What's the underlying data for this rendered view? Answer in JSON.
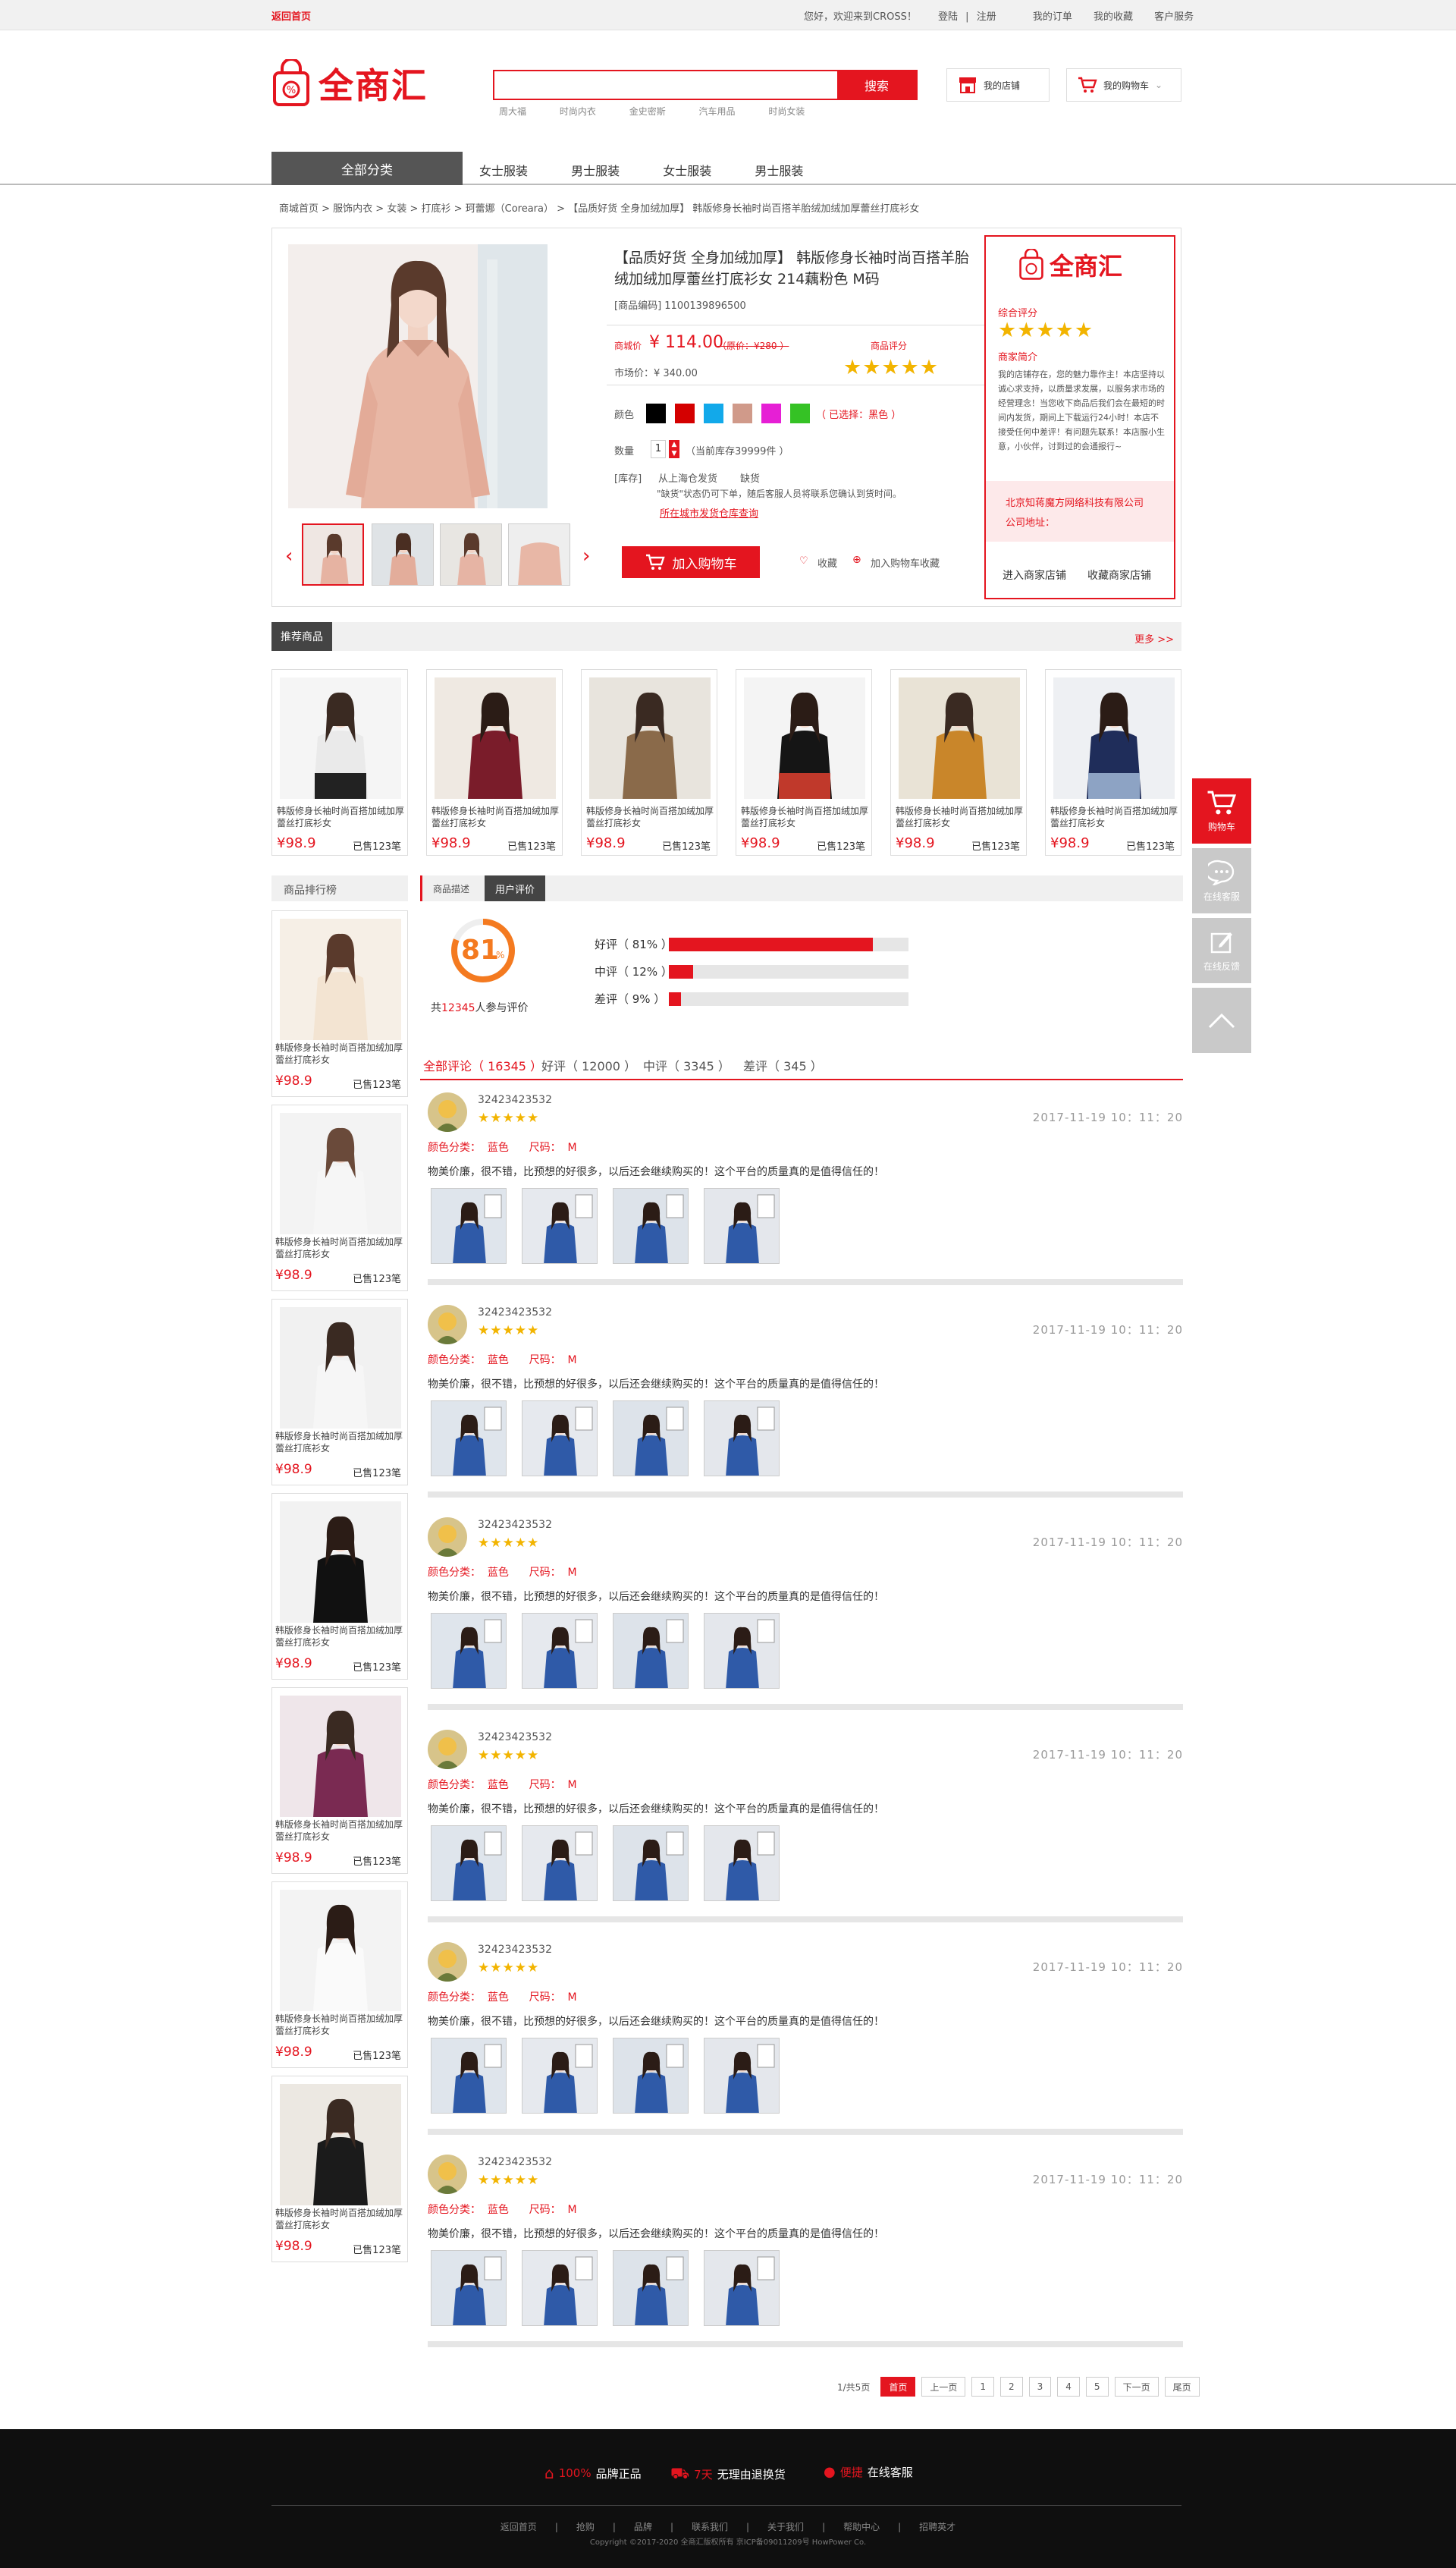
{
  "topbar": {
    "home": "返回首页",
    "greeting": "您好，欢迎来到CROSS！",
    "login": "登陆",
    "sep": "|",
    "register": "注册",
    "orders": "我的订单",
    "favorites": "我的收藏",
    "service": "客户服务"
  },
  "header": {
    "logo": "全商汇",
    "search_placeholder": "",
    "search_btn": "搜索",
    "hot": [
      "周大福",
      "时尚内衣",
      "金史密斯",
      "汽车用品",
      "时尚女装"
    ],
    "store": "我的店铺",
    "cart": "我的购物车"
  },
  "nav": {
    "all": "全部分类",
    "items": [
      "女士服装",
      "男士服装",
      "女士服装",
      "男士服装"
    ]
  },
  "crumb": "商城首页 > 服饰内衣 > 女装 > 打底衫 > 珂蕾娜（Coreara） > 【品质好货 全身加绒加厚】 韩版修身长袖时尚百搭羊胎绒加绒加厚蕾丝打底衫女",
  "product": {
    "title": "【品质好货 全身加绒加厚】 韩版修身长袖时尚百搭羊胎绒加绒加厚蕾丝打底衫女 214藕粉色 M码",
    "code": "[商品编码] 1100139896500",
    "price_label": "商城价",
    "price": "¥ 114.00",
    "orig": "（原价：¥280 ）",
    "market": "市场价：¥ 340.00",
    "rating_label": "商品评分",
    "stars": "★★★★★",
    "color_label": "颜色",
    "color_selected": "（ 已选择：黑色 ）",
    "qty_label": "数量",
    "qty": "1",
    "stock": "（当前库存39999件 ）",
    "ship_label": "[库存]",
    "ship_from": "从上海仓发货",
    "ship_state": "缺货",
    "ship_note": "\"缺货\"状态仍可下单，随后客服人员将联系您确认到货时间。",
    "ship_link": "所在城市发货仓库查询",
    "cart_btn": "加入购物车",
    "fav": "收藏",
    "fav_cart": "加入购物车收藏",
    "swatches": [
      "#000000",
      "#d40000",
      "#12a9ea",
      "#d09a8a",
      "#e61fd5",
      "#35c225"
    ]
  },
  "shop": {
    "logo": "全商汇",
    "score_label": "综合评分",
    "stars": "★★★★★",
    "intro_label": "商家简介",
    "intro": "我的店铺存在，您的魅力靠作主！本店坚持以诚心求支持，以质量求发展，以服务求市场的经营理念！当您收下商品后我们会在最短的时间内发货，期间上下载运行24小时！本店不接受任何中差评！有问题先联系！本店服小生意，小伙伴，讨到过的会通报行~",
    "company": "北京知蒋魔方网络科技有限公司",
    "address": "公司地址：",
    "enter": "进入商家店铺",
    "collect": "收藏商家店铺"
  },
  "recommend": {
    "title": "推荐商品",
    "more": "更多 >>",
    "items": [
      {
        "name": "韩版修身长袖时尚百搭加绒加厚蕾丝打底衫女",
        "price": "¥98.9",
        "sold": "已售123笔"
      },
      {
        "name": "韩版修身长袖时尚百搭加绒加厚蕾丝打底衫女",
        "price": "¥98.9",
        "sold": "已售123笔"
      },
      {
        "name": "韩版修身长袖时尚百搭加绒加厚蕾丝打底衫女",
        "price": "¥98.9",
        "sold": "已售123笔"
      },
      {
        "name": "韩版修身长袖时尚百搭加绒加厚蕾丝打底衫女",
        "price": "¥98.9",
        "sold": "已售123笔"
      },
      {
        "name": "韩版修身长袖时尚百搭加绒加厚蕾丝打底衫女",
        "price": "¥98.9",
        "sold": "已售123笔"
      },
      {
        "name": "韩版修身长袖时尚百搭加绒加厚蕾丝打底衫女",
        "price": "¥98.9",
        "sold": "已售123笔"
      }
    ]
  },
  "rank": {
    "title": "商品排行榜",
    "items": [
      {
        "name": "韩版修身长袖时尚百搭加绒加厚蕾丝打底衫女",
        "price": "¥98.9",
        "sold": "已售123笔"
      },
      {
        "name": "韩版修身长袖时尚百搭加绒加厚蕾丝打底衫女",
        "price": "¥98.9",
        "sold": "已售123笔"
      },
      {
        "name": "韩版修身长袖时尚百搭加绒加厚蕾丝打底衫女",
        "price": "¥98.9",
        "sold": "已售123笔"
      },
      {
        "name": "韩版修身长袖时尚百搭加绒加厚蕾丝打底衫女",
        "price": "¥98.9",
        "sold": "已售123笔"
      },
      {
        "name": "韩版修身长袖时尚百搭加绒加厚蕾丝打底衫女",
        "price": "¥98.9",
        "sold": "已售123笔"
      },
      {
        "name": "韩版修身长袖时尚百搭加绒加厚蕾丝打底衫女",
        "price": "¥98.9",
        "sold": "已售123笔"
      },
      {
        "name": "韩版修身长袖时尚百搭加绒加厚蕾丝打底衫女",
        "price": "¥98.9",
        "sold": "已售123笔"
      }
    ]
  },
  "tabs": {
    "desc": "商品描述",
    "reviews": "用户评价"
  },
  "summary": {
    "score": "81",
    "unit": "%",
    "count_pre": "共",
    "count": "12345",
    "count_post": "人参与评价",
    "bars": [
      {
        "label": "好评（ 81% ）",
        "value": 0.85
      },
      {
        "label": "中评（ 12% ）",
        "value": 0.1
      },
      {
        "label": "差评（ 9% ）",
        "value": 0.05
      }
    ]
  },
  "filters": [
    "全部评论（ 16345 ）",
    "好评（ 12000 ）",
    "中评（ 3345 ）",
    "差评（ 345 ）"
  ],
  "reviews": [
    {
      "user": "32423423532",
      "stars": "★★★★★",
      "time": "2017-11-19  10：11：20",
      "opt": "颜色分类：  蓝色      尺码：  M",
      "text": "物美价廉，很不错，比预想的好很多，以后还会继续购买的！这个平台的质量真的是值得信任的！"
    },
    {
      "user": "32423423532",
      "stars": "★★★★★",
      "time": "2017-11-19  10：11：20",
      "opt": "颜色分类：  蓝色      尺码：  M",
      "text": "物美价廉，很不错，比预想的好很多，以后还会继续购买的！这个平台的质量真的是值得信任的！"
    },
    {
      "user": "32423423532",
      "stars": "★★★★★",
      "time": "2017-11-19  10：11：20",
      "opt": "颜色分类：  蓝色      尺码：  M",
      "text": "物美价廉，很不错，比预想的好很多，以后还会继续购买的！这个平台的质量真的是值得信任的！"
    },
    {
      "user": "32423423532",
      "stars": "★★★★★",
      "time": "2017-11-19  10：11：20",
      "opt": "颜色分类：  蓝色      尺码：  M",
      "text": "物美价廉，很不错，比预想的好很多，以后还会继续购买的！这个平台的质量真的是值得信任的！"
    },
    {
      "user": "32423423532",
      "stars": "★★★★★",
      "time": "2017-11-19  10：11：20",
      "opt": "颜色分类：  蓝色      尺码：  M",
      "text": "物美价廉，很不错，比预想的好很多，以后还会继续购买的！这个平台的质量真的是值得信任的！"
    },
    {
      "user": "32423423532",
      "stars": "★★★★★",
      "time": "2017-11-19  10：11：20",
      "opt": "颜色分类：  蓝色      尺码：  M",
      "text": "物美价廉，很不错，比预想的好很多，以后还会继续购买的！这个平台的质量真的是值得信任的！"
    }
  ],
  "pager": {
    "info": "1/共5页",
    "first": "首页",
    "prev": "上一页",
    "pages": [
      "1",
      "2",
      "3",
      "4",
      "5"
    ],
    "next": "下一页",
    "last": "尾页"
  },
  "footer": {
    "f1_pre": "100%",
    "f1": "品牌正品",
    "f2_pre": "7天",
    "f2": "无理由退换货",
    "f3_pre": "便捷",
    "f3": "在线客服",
    "links": [
      "返回首页",
      "|",
      "抢购",
      "|",
      "品牌",
      "|",
      "联系我们",
      "|",
      "关于我们",
      "|",
      "帮助中心",
      "|",
      "招聘英才"
    ],
    "copy": "Copyright ©2017-2020 全商汇版权所有 京ICP备09011209号 HowPower Co."
  },
  "float": {
    "cart": "购物车",
    "chat": "在线客服",
    "feedback": "在线反馈"
  }
}
